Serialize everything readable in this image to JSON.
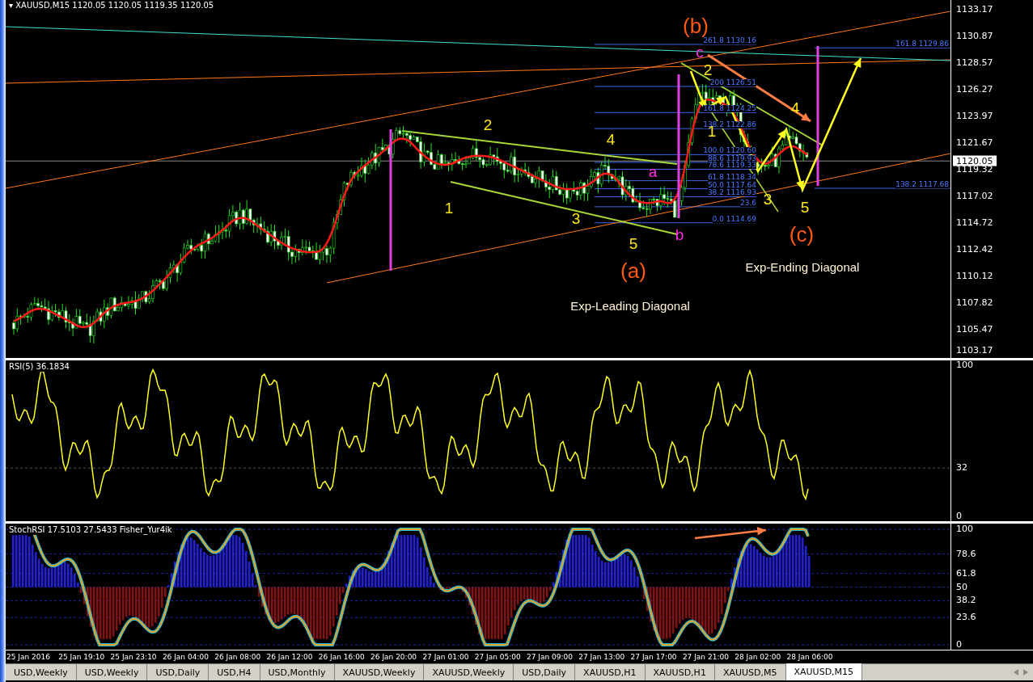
{
  "header": {
    "title": "▾ XAUUSD,M15  1120.05 1120.05 1119.35 1120.05"
  },
  "main_chart": {
    "price_ticks": [
      "1133.17",
      "1130.87",
      "1128.57",
      "1126.27",
      "1123.97",
      "1121.67",
      "1119.32",
      "1117.02",
      "1114.72",
      "1112.42",
      "1110.12",
      "1107.82",
      "1105.47",
      "1103.17"
    ],
    "current_price": "1120.05",
    "fib_levels": [
      "261.8 1130.16",
      "200 1126.51",
      "161.8 1124.25",
      "138.2 1122.86",
      "100.0 1120.60",
      "88.6 1119.93",
      "78.6 1119.33",
      "61.8 1118.34",
      "50.0 1117.64",
      "38.2 1116.93",
      "23.6",
      "0.0 1114.69"
    ],
    "fib_extensions": [
      "161.8 1129.86",
      "138.2 1117.68"
    ],
    "wave_labels": [
      {
        "text": "(b)",
        "kind": "degree"
      },
      {
        "text": "c",
        "kind": "sub"
      },
      {
        "text": "2",
        "kind": "minor"
      },
      {
        "text": "4",
        "kind": "minor"
      },
      {
        "text": "1",
        "kind": "minor"
      },
      {
        "text": "3",
        "kind": "minor"
      },
      {
        "text": "5",
        "kind": "minor"
      },
      {
        "text": "(c)",
        "kind": "degree"
      },
      {
        "text": "Exp-Ending Diagonal",
        "kind": "caption"
      },
      {
        "text": "2",
        "kind": "minor"
      },
      {
        "text": "4",
        "kind": "minor"
      },
      {
        "text": "a",
        "kind": "sub"
      },
      {
        "text": "1",
        "kind": "minor"
      },
      {
        "text": "3",
        "kind": "minor"
      },
      {
        "text": "5",
        "kind": "minor"
      },
      {
        "text": "b",
        "kind": "sub"
      },
      {
        "text": "(a)",
        "kind": "degree"
      },
      {
        "text": "Exp-Leading Diagonal",
        "kind": "caption"
      }
    ]
  },
  "rsi": {
    "title": "RSI(5) 36.1834",
    "ticks": [
      "100",
      "32",
      "0"
    ]
  },
  "stoch": {
    "title": "StochRSI 17.5103 27.5433  Fisher_Yur4ik",
    "ticks": [
      "100",
      "78.6",
      "61.8",
      "50",
      "38.2",
      "23.6",
      "0"
    ]
  },
  "time_axis": [
    "25 Jan 2016",
    "25 Jan 19:10",
    "25 Jan 23:10",
    "26 Jan 04:00",
    "26 Jan 08:00",
    "26 Jan 12:00",
    "26 Jan 16:00",
    "26 Jan 20:00",
    "27 Jan 01:00",
    "27 Jan 05:00",
    "27 Jan 09:00",
    "27 Jan 13:00",
    "27 Jan 17:00",
    "27 Jan 21:00",
    "28 Jan 02:00",
    "28 Jan 06:00"
  ],
  "tabs": [
    {
      "label": "USD,Weekly",
      "selected": false
    },
    {
      "label": "USD,Weekly",
      "selected": false
    },
    {
      "label": "USD,Daily",
      "selected": false
    },
    {
      "label": "USD,H4",
      "selected": false
    },
    {
      "label": "USD,Monthly",
      "selected": false
    },
    {
      "label": "XAUUSD,Weekly",
      "selected": false
    },
    {
      "label": "XAUUSD,Weekly",
      "selected": false
    },
    {
      "label": "USD,Daily",
      "selected": false
    },
    {
      "label": "XAUUSD,H1",
      "selected": false
    },
    {
      "label": "XAUUSD,H1",
      "selected": false
    },
    {
      "label": "XAUUSD,M5",
      "selected": false
    },
    {
      "label": "XAUUSD,M15",
      "selected": true
    }
  ]
}
